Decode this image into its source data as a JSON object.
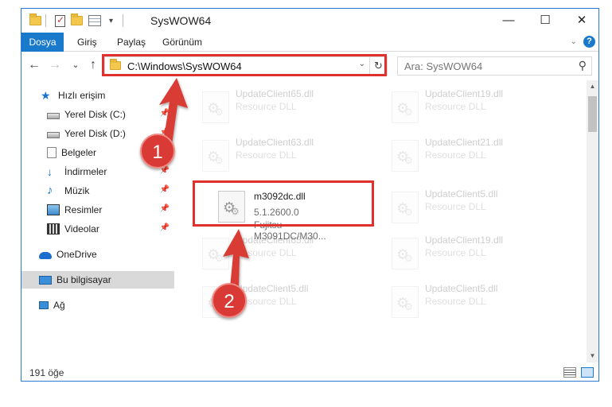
{
  "window": {
    "title": "SysWOW64",
    "controls": {
      "minimize": "—",
      "maximize": "☐",
      "close": "✕"
    }
  },
  "ribbon": {
    "tabs": [
      {
        "label": "Dosya",
        "active": true
      },
      {
        "label": "Giriş"
      },
      {
        "label": "Paylaş"
      },
      {
        "label": "Görünüm"
      }
    ],
    "help": "?"
  },
  "nav": {
    "back": "←",
    "forward": "→",
    "recent": "⌄",
    "up": "↑",
    "address_path": "C:\\Windows\\SysWOW64",
    "search_placeholder": "Ara: SysWOW64"
  },
  "sidebar": {
    "items": [
      {
        "label": "Hızlı erişim",
        "icon": "star-icon"
      },
      {
        "label": "Yerel Disk (C:)",
        "icon": "disk-icon",
        "pinned": true
      },
      {
        "label": "Yerel Disk (D:)",
        "icon": "disk-icon",
        "pinned": true
      },
      {
        "label": "Belgeler",
        "icon": "documents-icon",
        "pinned": true
      },
      {
        "label": "İndirmeler",
        "icon": "download-icon",
        "pinned": true
      },
      {
        "label": "Müzik",
        "icon": "music-icon",
        "pinned": true
      },
      {
        "label": "Resimler",
        "icon": "pictures-icon",
        "pinned": true
      },
      {
        "label": "Videolar",
        "icon": "videos-icon",
        "pinned": true
      },
      {
        "label": "OneDrive",
        "icon": "cloud-icon"
      },
      {
        "label": "Bu bilgisayar",
        "icon": "computer-icon",
        "selected": true
      },
      {
        "label": "Ağ",
        "icon": "network-icon"
      }
    ]
  },
  "files": [
    {
      "name": "UpdateClient65.dll",
      "type": "Resource DLL",
      "faded": true
    },
    {
      "name": "UpdateClient19.dll",
      "type": "Resource DLL",
      "faded": true
    },
    {
      "name": "UpdateClient63.dll",
      "type": "Resource DLL",
      "faded": true
    },
    {
      "name": "UpdateClient21.dll",
      "type": "Resource DLL",
      "faded": true
    },
    {
      "name": "m3092dc.dll",
      "version": "5.1.2600.0",
      "description": "Fujitsu M3091DC/M30...",
      "faded": false
    },
    {
      "name": "UpdateClient5.dll",
      "type": "Resource DLL",
      "faded": true
    },
    {
      "name": "UpdateClient65.dll",
      "type": "Resource DLL",
      "faded": true
    },
    {
      "name": "UpdateClient19.dll",
      "type": "Resource DLL",
      "faded": true
    },
    {
      "name": "UpdateClient5.dll",
      "type": "Resource DLL",
      "faded": true
    },
    {
      "name": "UpdateClient5.dll",
      "type": "Resource DLL",
      "faded": true
    }
  ],
  "status": {
    "item_count": "191 öğe"
  },
  "annotations": [
    {
      "number": "1",
      "color": "#d93a35"
    },
    {
      "number": "2",
      "color": "#d93a35"
    }
  ]
}
